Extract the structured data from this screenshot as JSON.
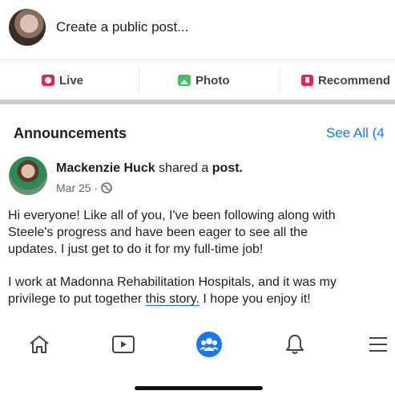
{
  "composer": {
    "placeholder": "Create a public post..."
  },
  "actions": [
    {
      "label": "Live",
      "icon": "live-video-icon",
      "color": "#e4254f"
    },
    {
      "label": "Photo",
      "icon": "photo-icon",
      "color": "#45bd62"
    },
    {
      "label": "Recommend",
      "icon": "recommend-icon",
      "color": "#e4254f"
    }
  ],
  "announcements": {
    "title": "Announcements",
    "see_all": "See All (4"
  },
  "post": {
    "author": "Mackenzie Huck",
    "action_prefix": " shared a ",
    "action_object": "post.",
    "date": "Mar 25 ·",
    "body_line1": "Hi everyone! Like all of you, I've been following along with",
    "body_line2": "Steele's progress and have been eager to see all the",
    "body_line3": "updates. I just get to do it for my full-time job!",
    "body_line4": "I work at Madonna Rehabilitation Hospitals, and it was my",
    "body_line5_pre": "privilege to put together ",
    "body_line5_link": "this story.",
    "body_line5_post": " I hope you enjoy it!"
  },
  "tabbar": {
    "items": [
      "home-icon",
      "watch-icon",
      "groups-icon",
      "notifications-icon",
      "menu-icon"
    ],
    "active_color": "#1877f2"
  }
}
